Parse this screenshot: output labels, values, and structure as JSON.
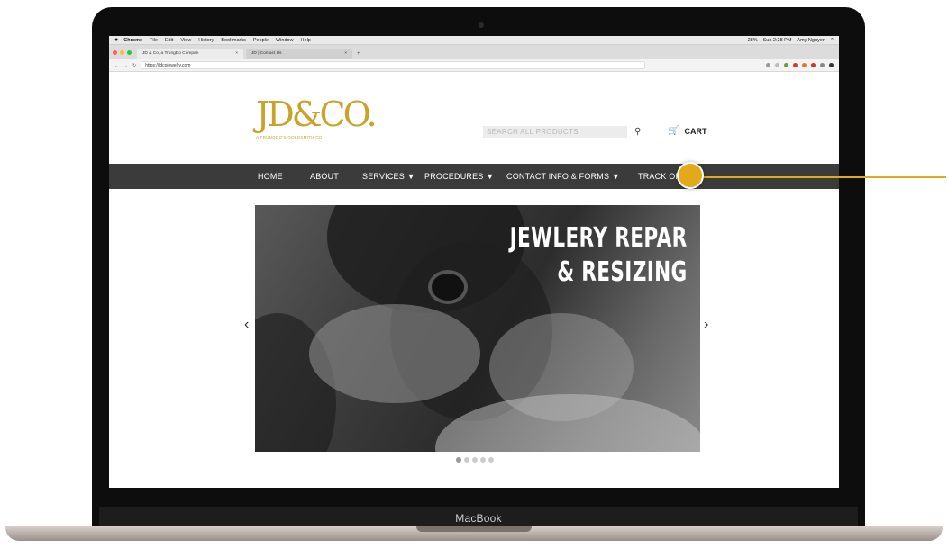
{
  "device": {
    "brand_label": "MacBook"
  },
  "menubar": {
    "app": "Chrome",
    "items": [
      "File",
      "Edit",
      "View",
      "History",
      "Bookmarks",
      "People",
      "Window",
      "Help"
    ],
    "status": {
      "battery": "28%",
      "clock": "Sun 2:28 PM",
      "user": "Amy Nguyen"
    }
  },
  "browser": {
    "tabs": [
      {
        "title": "JD & Co, a TrungDo Compan",
        "close": "×"
      },
      {
        "title": "JD | Contact Us",
        "close": "×"
      }
    ],
    "new_tab": "+",
    "url": "https://jdcojewelry.com"
  },
  "site": {
    "logo": {
      "text": "JD&CO.",
      "tagline": "A TRUNGDO'S GOLDSMITH CO"
    },
    "search": {
      "placeholder": "SEARCH ALL PRODUCTS"
    },
    "cart": {
      "label": "CART"
    },
    "nav": [
      "HOME",
      "ABOUT",
      "SERVICES ▼",
      "PROCEDURES ▼",
      "CONTACT INFO & FORMS ▼",
      "TRACK OR"
    ],
    "hero": {
      "line1": "JEWLERY REPAR",
      "line2": "& RESIZING",
      "prev": "‹",
      "next": "›"
    },
    "slider": {
      "count": 5,
      "active": 1
    }
  },
  "colors": {
    "accent": "#c9a227",
    "callout": "#e3a91b",
    "nav_bg": "#3b3b3b"
  }
}
